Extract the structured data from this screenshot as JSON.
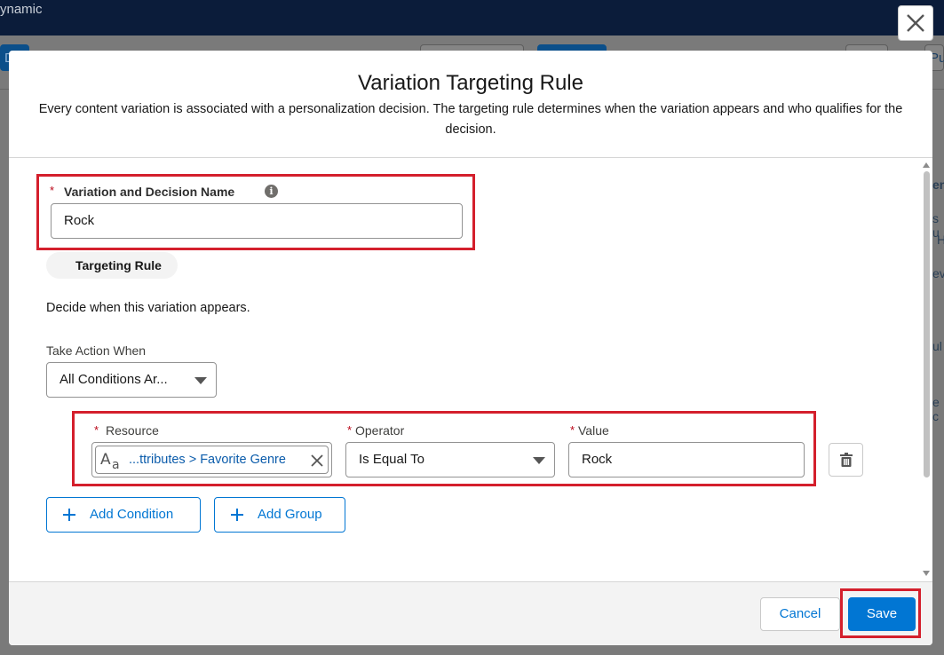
{
  "background": {
    "app_name": "ynamic",
    "left_btn_label": "D",
    "right_btn_label": "Pu",
    "side_fragments": [
      "en",
      "s u",
      "H",
      "ev",
      "ul",
      "e c"
    ]
  },
  "modal": {
    "title": "Variation Targeting Rule",
    "description": "Every content variation is associated with a personalization decision. The targeting rule determines when the variation appears and who qualifies for the decision.",
    "name_field": {
      "required_mark": "*",
      "label": "Variation and Decision Name",
      "info_glyph": "i",
      "value": "Rock"
    },
    "tab_label": "Targeting Rule",
    "helper_text": "Decide when this variation appears.",
    "take_action": {
      "label": "Take Action When",
      "selected": "All Conditions Ar..."
    },
    "condition": {
      "resource_label": "Resource",
      "resource_icon_text": "Aa",
      "resource_value": "...ttributes > Favorite Genre",
      "operator_label": "Operator",
      "operator_value": "Is Equal To",
      "value_label": "Value",
      "value_value": "Rock"
    },
    "add_condition_label": "Add Condition",
    "add_group_label": "Add Group"
  },
  "footer": {
    "cancel_label": "Cancel",
    "save_label": "Save"
  },
  "icons": {
    "close": "close-icon",
    "info": "info-icon",
    "text_type": "text-type-icon",
    "clear": "clear-icon",
    "chevron": "chevron-down-icon",
    "delete": "delete-icon",
    "add": "add-icon"
  },
  "colors": {
    "brand": "#0176d3",
    "link": "#0b5cab",
    "required": "#ba0517",
    "highlight": "#d41f2c",
    "header_dark": "#0b1c3a"
  }
}
